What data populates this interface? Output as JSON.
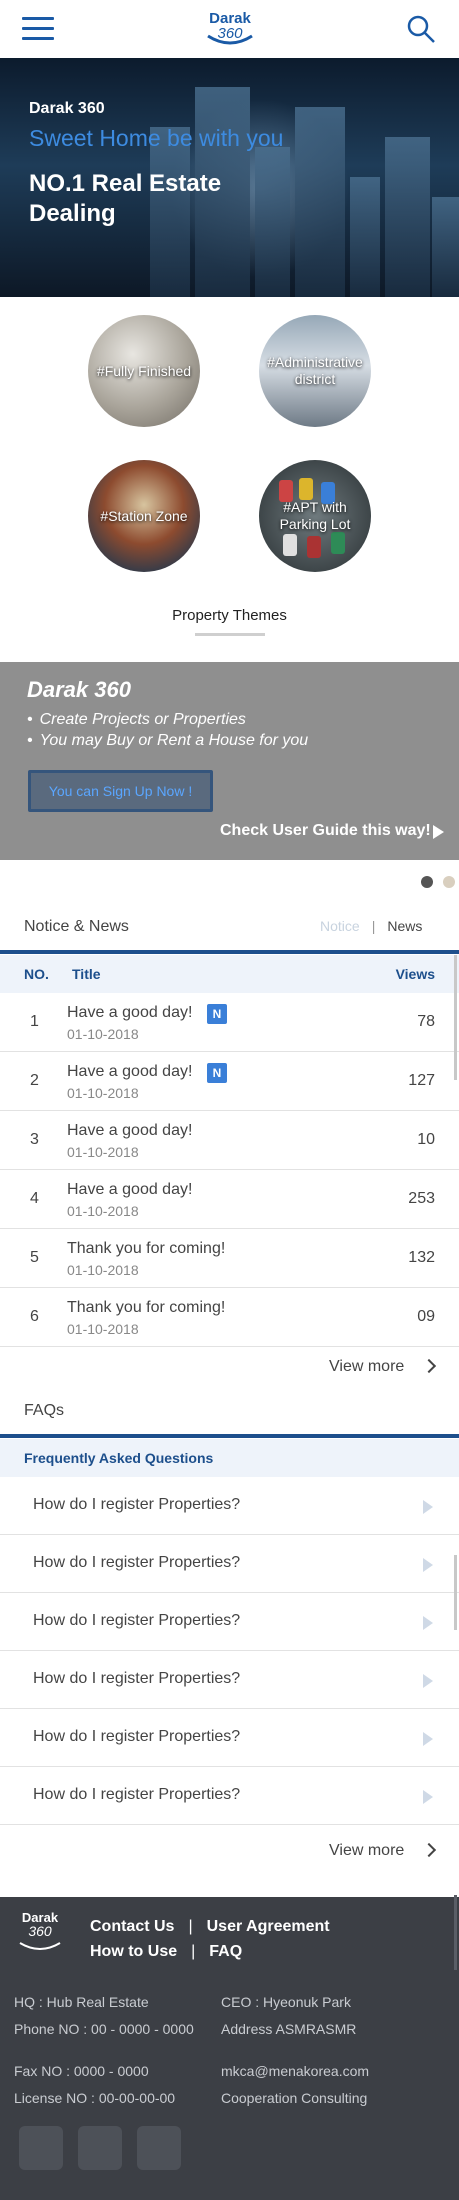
{
  "header": {
    "logo_word": "Darak",
    "logo_num": "360"
  },
  "hero": {
    "brand": "Darak 360",
    "tagline": "Sweet Home be with you",
    "headline": "NO.1 Real Estate Dealing"
  },
  "themes": {
    "items": [
      {
        "label": "#Fully Finished"
      },
      {
        "label": "#Administrative district"
      },
      {
        "label": "#Station Zone"
      },
      {
        "label": "#APT with Parking Lot"
      }
    ],
    "title": "Property Themes"
  },
  "promo": {
    "title": "Darak 360",
    "bullets": [
      "Create Projects or Properties",
      "You may Buy or Rent a House for you"
    ],
    "signup_label": "You can Sign Up Now !",
    "guide_label": "Check User Guide this way!"
  },
  "notice": {
    "title": "Notice & News",
    "tab_notice": "Notice",
    "tab_separator": "|",
    "tab_news": "News",
    "columns": {
      "no": "NO.",
      "title": "Title",
      "views": "Views"
    },
    "rows": [
      {
        "no": "1",
        "title": "Have a good day!",
        "badge": "N",
        "date": "01-10-2018",
        "views": "78"
      },
      {
        "no": "2",
        "title": "Have a good day!",
        "badge": "N",
        "date": "01-10-2018",
        "views": "127"
      },
      {
        "no": "3",
        "title": "Have a good day!",
        "badge": "",
        "date": "01-10-2018",
        "views": "10"
      },
      {
        "no": "4",
        "title": "Have a good day!",
        "badge": "",
        "date": "01-10-2018",
        "views": "253"
      },
      {
        "no": "5",
        "title": "Thank you for coming!",
        "badge": "",
        "date": "01-10-2018",
        "views": "132"
      },
      {
        "no": "6",
        "title": "Thank you for coming!",
        "badge": "",
        "date": "01-10-2018",
        "views": "09"
      }
    ],
    "view_more": "View more"
  },
  "faq": {
    "title": "FAQs",
    "header": "Frequently Asked Questions",
    "items": [
      "How do I register Properties?",
      "How do I register Properties?",
      "How do I register Properties?",
      "How do I register Properties?",
      "How do I register Properties?",
      "How do I register Properties?"
    ],
    "view_more": "View more"
  },
  "footer": {
    "logo_word": "Darak",
    "logo_num": "360",
    "links": {
      "contact": "Contact Us",
      "agreement": "User Agreement",
      "how_to_use": "How to Use",
      "faq": "FAQ",
      "separator": "|"
    },
    "hq": "HQ : Hub Real Estate",
    "phone": "Phone NO : 00 - 0000 - 0000",
    "ceo": "CEO : Hyeonuk Park",
    "address": "Address ASMRASMR",
    "fax": "Fax NO : 0000 - 0000",
    "license": "License NO : 00-00-00-00",
    "email": "mkca@menakorea.com",
    "cooperation": "Cooperation Consulting"
  },
  "colors": {
    "brand_blue": "#1d4f8c",
    "accent_blue": "#3d8be0",
    "footer_bg": "#3c3f45",
    "promo_bg": "#8f8f8f"
  },
  "icons": {
    "menu": "hamburger-menu-icon",
    "search": "search-icon",
    "new_badge": "new-badge",
    "next": "chevron-right-icon",
    "expand": "triangle-right-icon"
  }
}
